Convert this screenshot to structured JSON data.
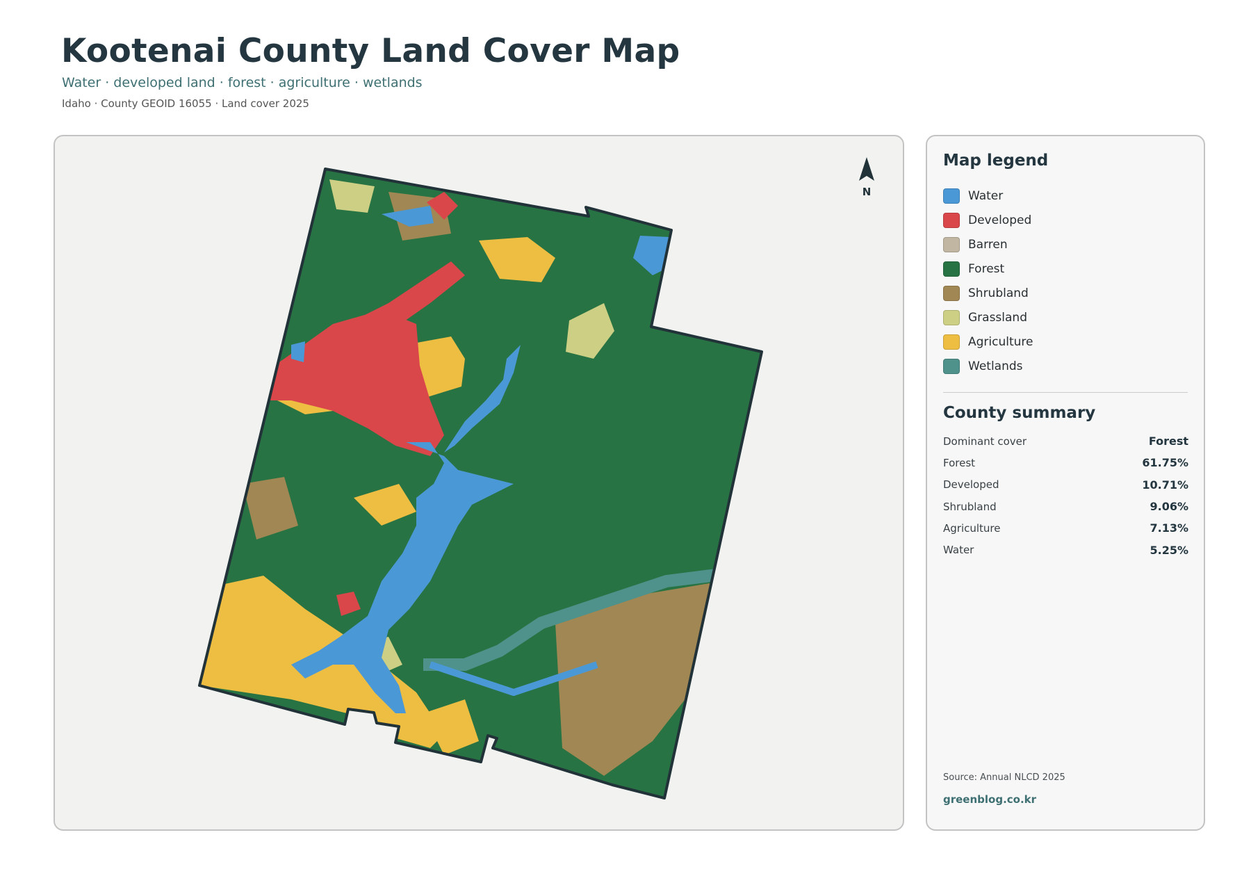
{
  "header": {
    "title": "Kootenai County Land Cover Map",
    "subtitle": "Water · developed land · forest · agriculture · wetlands",
    "meta": "Idaho · County GEOID 16055 · Land cover 2025"
  },
  "map": {
    "north_label": "N",
    "colors": {
      "water": "#4b98d6",
      "developed": "#d9474a",
      "barren": "#c1b6a2",
      "forest": "#287343",
      "shrubland": "#a18753",
      "grassland": "#cdcf84",
      "agriculture": "#eebe43",
      "wetlands": "#4f918b",
      "boundary": "#213238"
    }
  },
  "legend": {
    "title": "Map legend",
    "items": [
      {
        "label": "Water",
        "color": "#4b98d6"
      },
      {
        "label": "Developed",
        "color": "#d9474a"
      },
      {
        "label": "Barren",
        "color": "#c1b6a2"
      },
      {
        "label": "Forest",
        "color": "#287343"
      },
      {
        "label": "Shrubland",
        "color": "#a18753"
      },
      {
        "label": "Grassland",
        "color": "#cdcf84"
      },
      {
        "label": "Agriculture",
        "color": "#eebe43"
      },
      {
        "label": "Wetlands",
        "color": "#4f918b"
      }
    ]
  },
  "summary": {
    "title": "County summary",
    "rows": [
      {
        "label": "Dominant cover",
        "value": "Forest"
      },
      {
        "label": "Forest",
        "value": "61.75%"
      },
      {
        "label": "Developed",
        "value": "10.71%"
      },
      {
        "label": "Shrubland",
        "value": "9.06%"
      },
      {
        "label": "Agriculture",
        "value": "7.13%"
      },
      {
        "label": "Water",
        "value": "5.25%"
      }
    ]
  },
  "footer": {
    "source": "Source: Annual NLCD 2025",
    "site": "greenblog.co.kr"
  }
}
